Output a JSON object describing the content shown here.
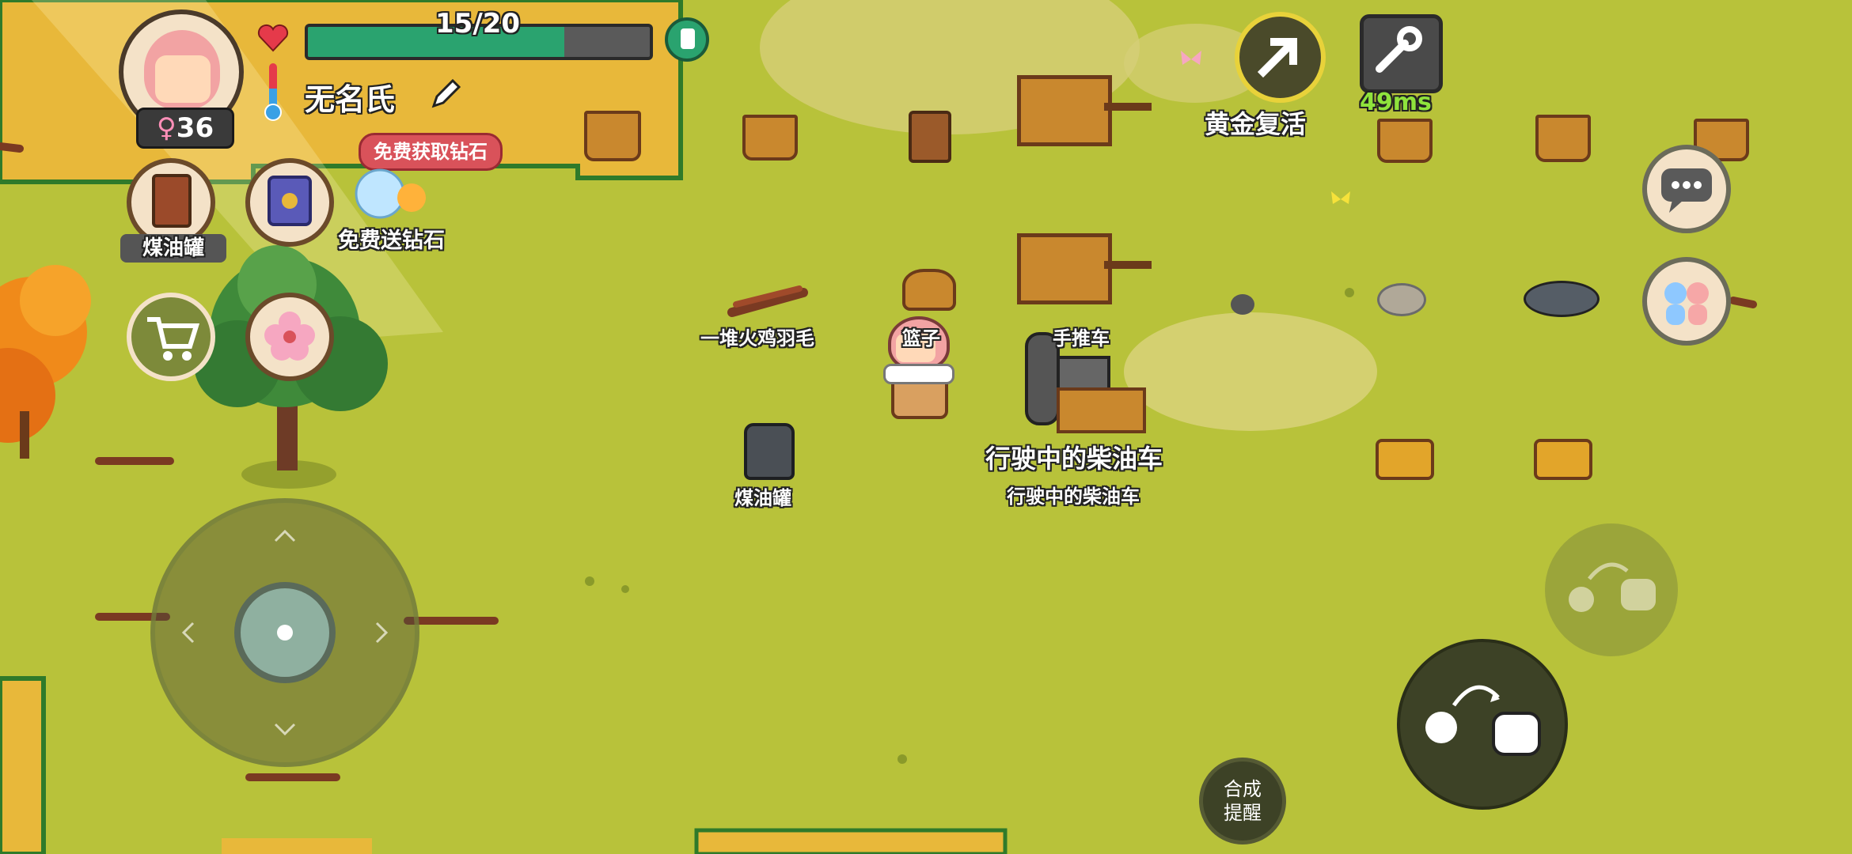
{
  "player": {
    "name": "无名氏",
    "gender_symbol": "♀",
    "age": "36",
    "health_text": "15/20",
    "health_fraction": 0.75
  },
  "promo": {
    "get_diamonds_badge": "免费获取钻石",
    "free_diamonds_label": "免费送钻石"
  },
  "hotbar": {
    "slot1_label": "煤油罐"
  },
  "top_right": {
    "golden_revive_label": "黄金复活",
    "ping_text": "49ms"
  },
  "world_labels": {
    "turkey_feathers": "一堆火鸡羽毛",
    "basket": "篮子",
    "handcart": "手推车",
    "diesel_truck_main": "行驶中的柴油车",
    "diesel_truck_sub": "行驶中的柴油车",
    "kerosene_can": "煤油罐"
  },
  "buttons": {
    "craft_reminder_label": "合成\n提醒"
  },
  "colors": {
    "health_bar": "#2aa36f",
    "badge_red": "#d9525a",
    "ping_green": "#8fe33c",
    "grass": "#b8c23a",
    "sand": "#e7b93a"
  },
  "icons": {
    "health": "heart-icon",
    "temperature": "thermometer-icon",
    "edit_name": "pencil-icon",
    "backpack": "backpack-icon",
    "settings": "wrench-icon",
    "revive": "arrow-up-right-icon",
    "chat": "chat-bubble-icon",
    "friends": "two-people-icon",
    "shop": "shopping-cart-icon",
    "flower": "blossom-icon",
    "journal": "book-icon"
  }
}
